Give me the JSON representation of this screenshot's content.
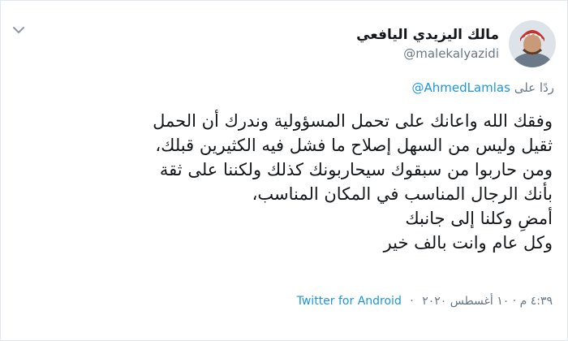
{
  "tweet": {
    "author": {
      "display_name": "مالك اليزيدي اليافعي",
      "handle": "@malekalyazidi"
    },
    "reply_prefix": "ردًا على",
    "reply_to": "@AhmedLamlas",
    "text_lines": [
      "وفقك الله واعانك على تحمل المسؤولية وندرك أن الحمل",
      "ثقيل وليس من السهل إصلاح ما فشل فيه الكثيرين قبلك،",
      "ومن حاربوا من سبقوك سيحاربونك كذلك ولكننا على ثقة",
      "بأنك الرجال المناسب في المكان المناسب،",
      "أمضِ وكلنا إلى جانبك",
      "وكل عام وانت بالف خير"
    ],
    "timestamp": "٤:٣٩ م · ١٠ أغسطس ٢٠٢٠",
    "separator": "·",
    "source": "Twitter for Android"
  },
  "icons": {
    "menu": "chevron-down-icon",
    "avatar": "avatar"
  },
  "colors": {
    "link": "#1b95e0",
    "secondary": "#657786",
    "text": "#14171a",
    "border": "#e1e8ed"
  }
}
